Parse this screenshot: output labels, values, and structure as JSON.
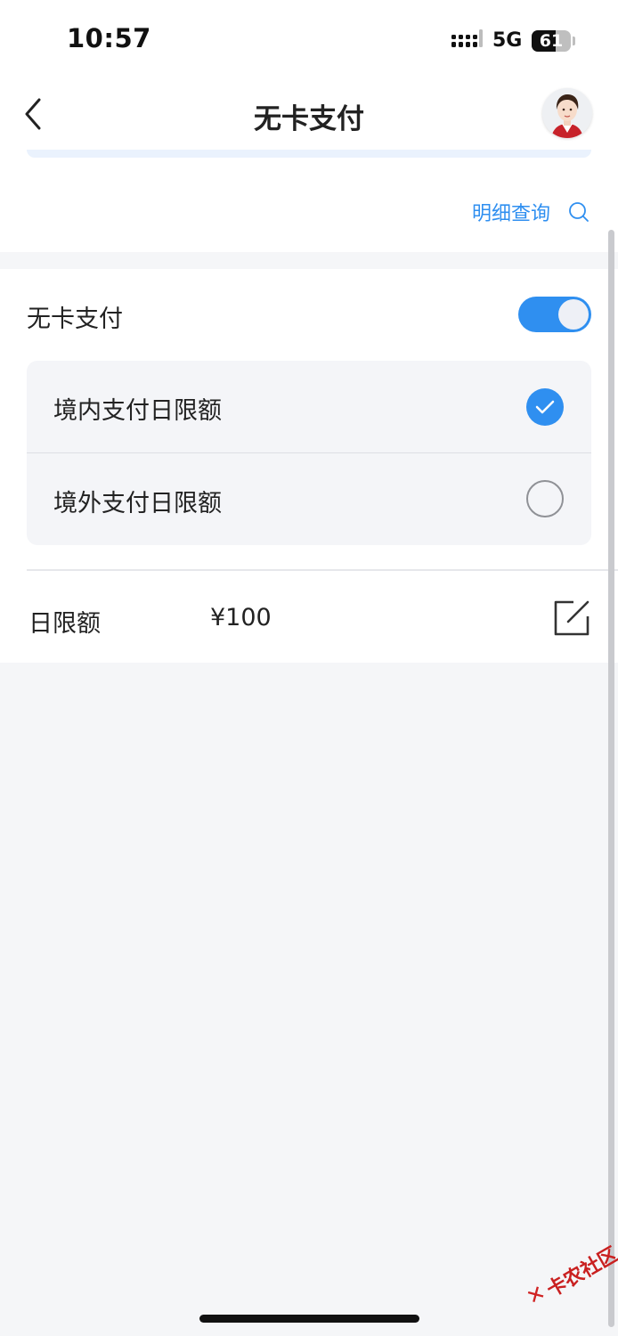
{
  "status_bar": {
    "time": "10:57",
    "network": "5G",
    "battery": "61",
    "battery_level_percent": 61
  },
  "nav": {
    "title": "无卡支付",
    "back_icon": "chevron-left-icon",
    "avatar_icon": "assistant-avatar"
  },
  "detail_query": {
    "label": "明细查询",
    "icon": "search-icon"
  },
  "settings": {
    "toggle_label": "无卡支付",
    "toggle_on": true,
    "options": [
      {
        "label": "境内支付日限额",
        "selected": true
      },
      {
        "label": "境外支付日限额",
        "selected": false
      }
    ],
    "limit_label": "日限额",
    "limit_value": "¥100",
    "edit_icon": "edit-icon"
  },
  "watermark": {
    "text": "卡农社区",
    "mark": "✕"
  },
  "colors": {
    "accent": "#2f8ff0",
    "background": "#f5f6f8",
    "card": "#ffffff",
    "option_bg": "#f4f5f8"
  }
}
